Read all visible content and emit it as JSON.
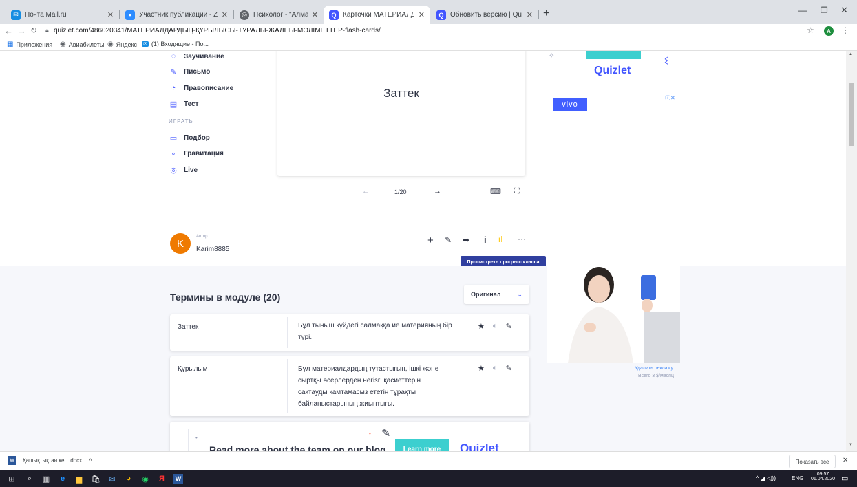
{
  "browser": {
    "tabs": [
      {
        "title": "Почта Mail.ru",
        "color": "#168de2"
      },
      {
        "title": "Участник публикации - Zoom",
        "color": "#2d8cff"
      },
      {
        "title": "Психолог - \"Алматы облыстық",
        "color": "#5f6368"
      },
      {
        "title": "Карточки МАТЕРИАЛДАРДЫҢ",
        "color": "#4255ff"
      },
      {
        "title": "Обновить версию | Quizlet",
        "color": "#4255ff"
      }
    ],
    "address": "quizlet.com/486020341/МАТЕРИАЛДАРДЫҢ-ҚҰРЫЛЫСЫ-ТУРАЛЫ-ЖАЛПЫ-МӘЛІМЕТТЕР-flash-cards/",
    "bookmarks": [
      "Приложения",
      "Авиабилеты",
      "Яндекс",
      "(1) Входящие - По..."
    ],
    "profile_letter": "A"
  },
  "study_menu": {
    "items": [
      "Заучивание",
      "Письмо",
      "Правописание",
      "Тест"
    ],
    "play_header": "ИГРАТЬ",
    "play_items": [
      "Подбор",
      "Гравитация",
      "Live"
    ]
  },
  "flashcard": {
    "term": "Заттек",
    "progress": "1/20"
  },
  "author": {
    "label": "Автор",
    "name": "Karim8885",
    "avatar_letter": "K"
  },
  "tooltip": "Просмотреть прогресс класса",
  "terms_section": {
    "title": "Термины в модуле (20)",
    "sort_value": "Оригинал",
    "rows": [
      {
        "term": "Заттек",
        "definition": [
          "Бұл тыныш күйдегі салмаққа ие материяның бір",
          "түрі."
        ]
      },
      {
        "term": "Құрылым",
        "definition": [
          "Бұл материалдардың тұтастығын, ішкі және",
          "сыртқы әсерлерден негізгі қасиеттерін",
          "сақтауды қамтамасыз ететін тұрақты",
          "байланыстарының жиынтығы."
        ]
      }
    ]
  },
  "promo": {
    "text": "Read more about the team on our blog",
    "button": "Learn more",
    "logo": "Quizlet"
  },
  "ads": {
    "top_logo": "Quizlet",
    "brand": "vivo",
    "remove_ad": "Удалить рекламу",
    "price": "Всего 3 $/месяц"
  },
  "downloads": {
    "file": "Қашықтықтан ке....docx",
    "show_all": "Показать все"
  },
  "taskbar": {
    "lang": "ENG",
    "time": "09:57",
    "date": "01.04.2020"
  }
}
